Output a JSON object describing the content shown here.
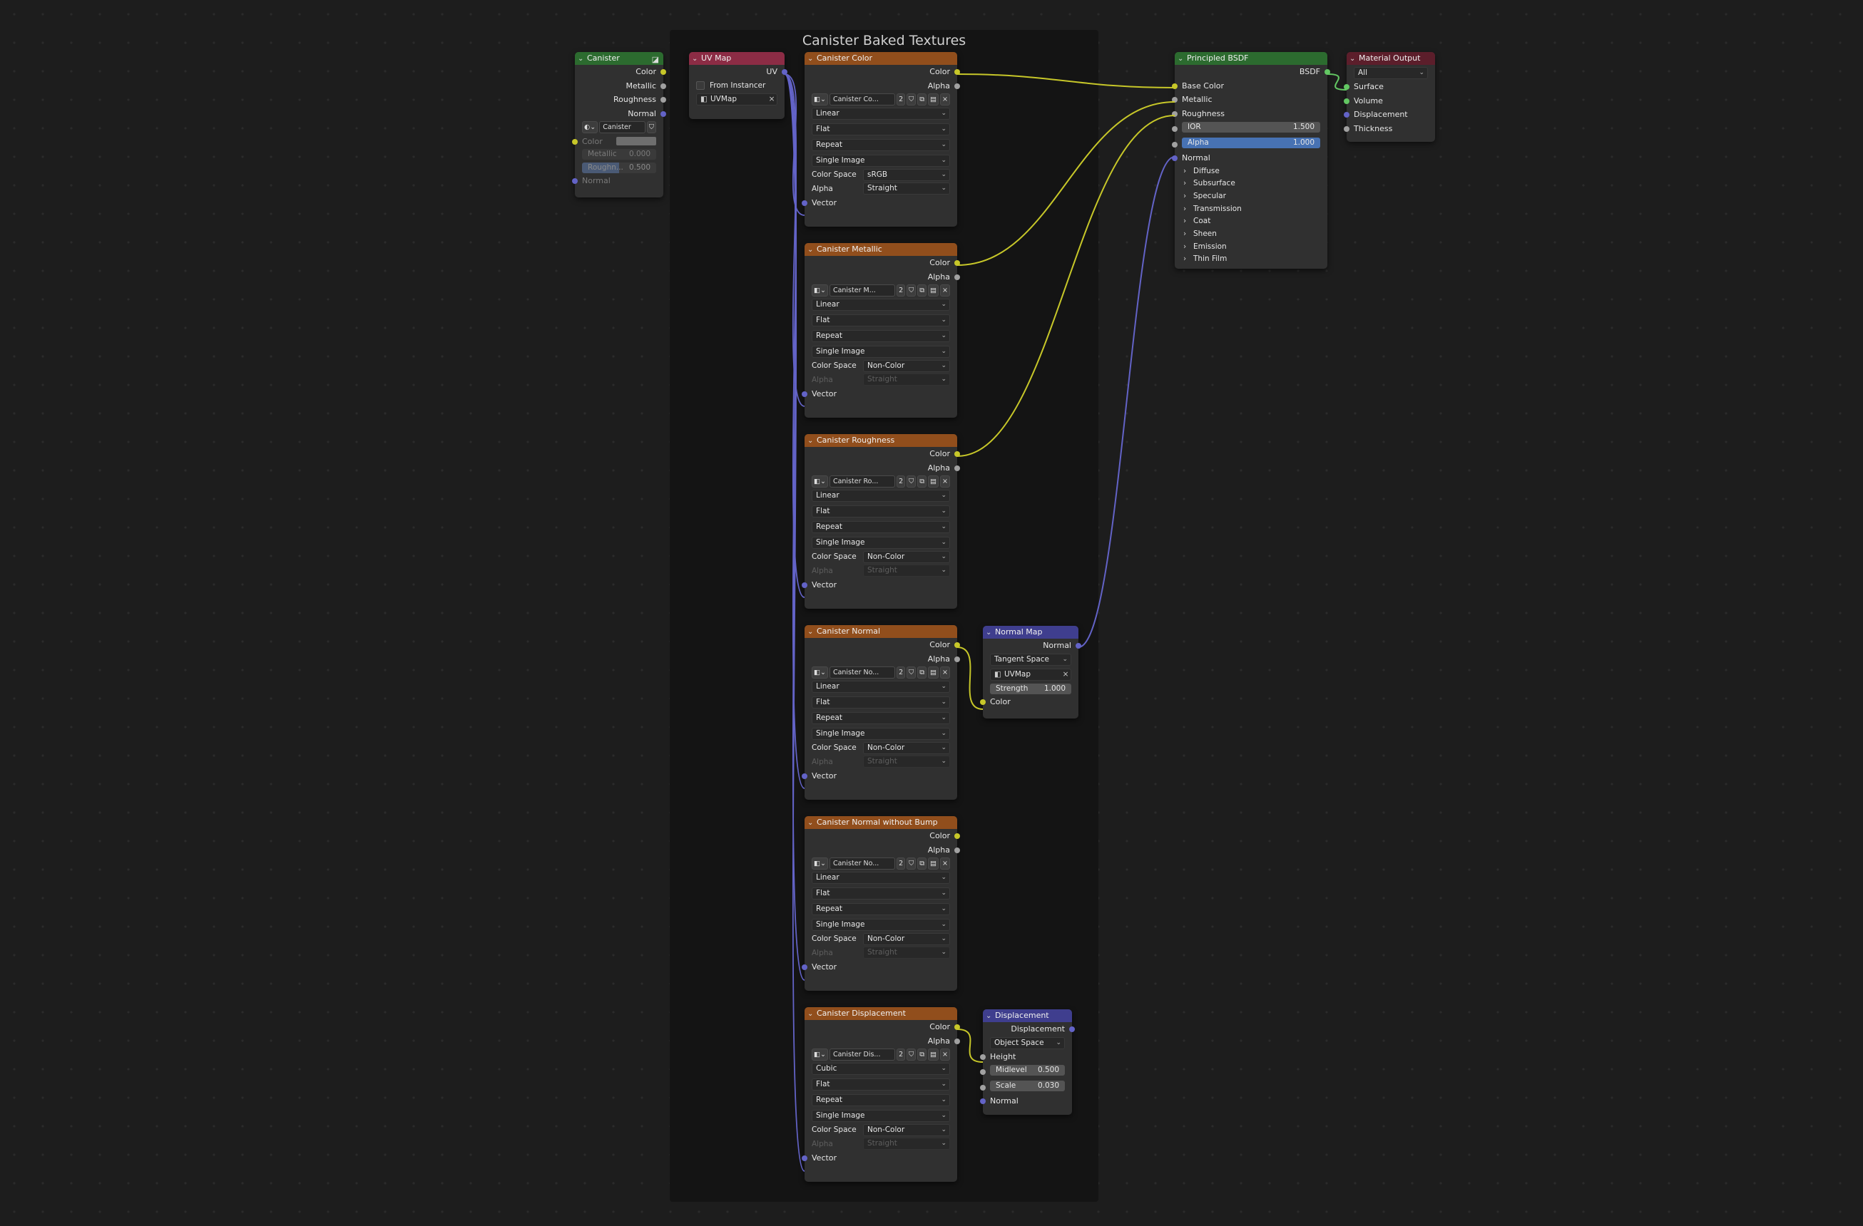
{
  "frame": {
    "title": "Canister Baked Textures"
  },
  "material_node": {
    "title": "Canister",
    "outputs": [
      "Color",
      "Metallic",
      "Roughness",
      "Normal"
    ],
    "material_name": "Canister",
    "inputs": {
      "color_label": "Color",
      "metallic_label": "Metallic",
      "metallic_value": "0.000",
      "roughness_label": "Roughn...",
      "roughness_value": "0.500",
      "normal_label": "Normal"
    }
  },
  "uvmap_node": {
    "title": "UV Map",
    "output": "UV",
    "from_instancer": "From Instancer",
    "map": "UVMap"
  },
  "image_nodes": [
    {
      "title": "Canister Color",
      "image": "Canister Co...",
      "users": "2",
      "interpolation": "Linear",
      "projection": "Flat",
      "extension": "Repeat",
      "source": "Single Image",
      "color_space": "sRGB",
      "alpha_mode": "Straight",
      "alpha_enabled": true
    },
    {
      "title": "Canister Metallic",
      "image": "Canister M...",
      "users": "2",
      "interpolation": "Linear",
      "projection": "Flat",
      "extension": "Repeat",
      "source": "Single Image",
      "color_space": "Non-Color",
      "alpha_mode": "Straight",
      "alpha_enabled": false
    },
    {
      "title": "Canister Roughness",
      "image": "Canister Ro...",
      "users": "2",
      "interpolation": "Linear",
      "projection": "Flat",
      "extension": "Repeat",
      "source": "Single Image",
      "color_space": "Non-Color",
      "alpha_mode": "Straight",
      "alpha_enabled": false
    },
    {
      "title": "Canister Normal",
      "image": "Canister No...",
      "users": "2",
      "interpolation": "Linear",
      "projection": "Flat",
      "extension": "Repeat",
      "source": "Single Image",
      "color_space": "Non-Color",
      "alpha_mode": "Straight",
      "alpha_enabled": false
    },
    {
      "title": "Canister Normal without Bump",
      "image": "Canister No...",
      "users": "2",
      "interpolation": "Linear",
      "projection": "Flat",
      "extension": "Repeat",
      "source": "Single Image",
      "color_space": "Non-Color",
      "alpha_mode": "Straight",
      "alpha_enabled": false
    },
    {
      "title": "Canister Displacement",
      "image": "Canister Dis...",
      "users": "2",
      "interpolation": "Cubic",
      "projection": "Flat",
      "extension": "Repeat",
      "source": "Single Image",
      "color_space": "Non-Color",
      "alpha_mode": "Straight",
      "alpha_enabled": false
    }
  ],
  "image_labels": {
    "out_color": "Color",
    "out_alpha": "Alpha",
    "color_space_label": "Color Space",
    "alpha_label": "Alpha",
    "vector": "Vector"
  },
  "normal_map_node": {
    "title": "Normal Map",
    "output": "Normal",
    "space": "Tangent Space",
    "uvmap": "UVMap",
    "strength_label": "Strength",
    "strength_value": "1.000",
    "input": "Color"
  },
  "displacement_node": {
    "title": "Displacement",
    "output": "Displacement",
    "space": "Object Space",
    "height": "Height",
    "midlevel_label": "Midlevel",
    "midlevel_value": "0.500",
    "scale_label": "Scale",
    "scale_value": "0.030",
    "normal": "Normal"
  },
  "bsdf_node": {
    "title": "Principled BSDF",
    "output": "BSDF",
    "inputs": [
      "Base Color",
      "Metallic",
      "Roughness"
    ],
    "ior_label": "IOR",
    "ior_value": "1.500",
    "alpha_label": "Alpha",
    "alpha_value": "1.000",
    "normal": "Normal",
    "panels": [
      "Diffuse",
      "Subsurface",
      "Specular",
      "Transmission",
      "Coat",
      "Sheen",
      "Emission",
      "Thin Film"
    ]
  },
  "output_node": {
    "title": "Material Output",
    "target": "All",
    "inputs": [
      "Surface",
      "Volume",
      "Displacement",
      "Thickness"
    ]
  },
  "colors": {
    "wire_color": "#c7c729",
    "wire_grey": "#a1a1a1",
    "wire_vector": "#6363c7",
    "wire_shader": "#63c763"
  },
  "icons": [
    "chevron-down-icon",
    "material-icon",
    "image-icon",
    "shield-icon",
    "duplicate-icon",
    "folder-icon",
    "close-icon",
    "chevron-right-icon"
  ]
}
